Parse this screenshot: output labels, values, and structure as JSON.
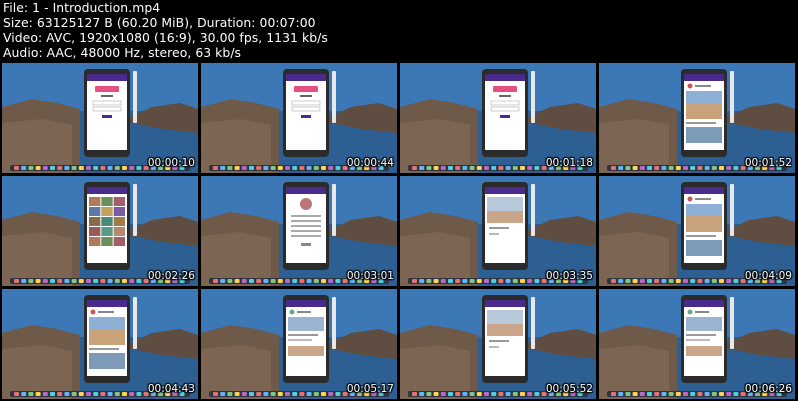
{
  "header": {
    "file_line": "File: 1 - Introduction.mp4",
    "size_line": "Size: 63125127 B (60.20 MiB), Duration: 00:07:00",
    "video_line": "Video: AVC, 1920x1080 (16:9), 30.00 fps, 1131 kb/s",
    "audio_line": "Audio: AAC, 48000 Hz, stereo, 63 kb/s"
  },
  "thumbnails": [
    {
      "timestamp": "00:00:10",
      "screen": "login"
    },
    {
      "timestamp": "00:00:44",
      "screen": "login"
    },
    {
      "timestamp": "00:01:18",
      "screen": "login"
    },
    {
      "timestamp": "00:01:52",
      "screen": "feed"
    },
    {
      "timestamp": "00:02:26",
      "screen": "grid"
    },
    {
      "timestamp": "00:03:01",
      "screen": "profile"
    },
    {
      "timestamp": "00:03:35",
      "screen": "image"
    },
    {
      "timestamp": "00:04:09",
      "screen": "feed"
    },
    {
      "timestamp": "00:04:43",
      "screen": "feed"
    },
    {
      "timestamp": "00:05:17",
      "screen": "post"
    },
    {
      "timestamp": "00:05:52",
      "screen": "image"
    },
    {
      "timestamp": "00:06:26",
      "screen": "post"
    }
  ],
  "colors": {
    "sky": "#3b78b5",
    "sea": "#2d5f93",
    "land": "#6f5a4a",
    "phone_body": "#2b2b2b",
    "app_bar": "#4a2a8c",
    "dock": "#2e3440",
    "accent": "#e1306c"
  }
}
